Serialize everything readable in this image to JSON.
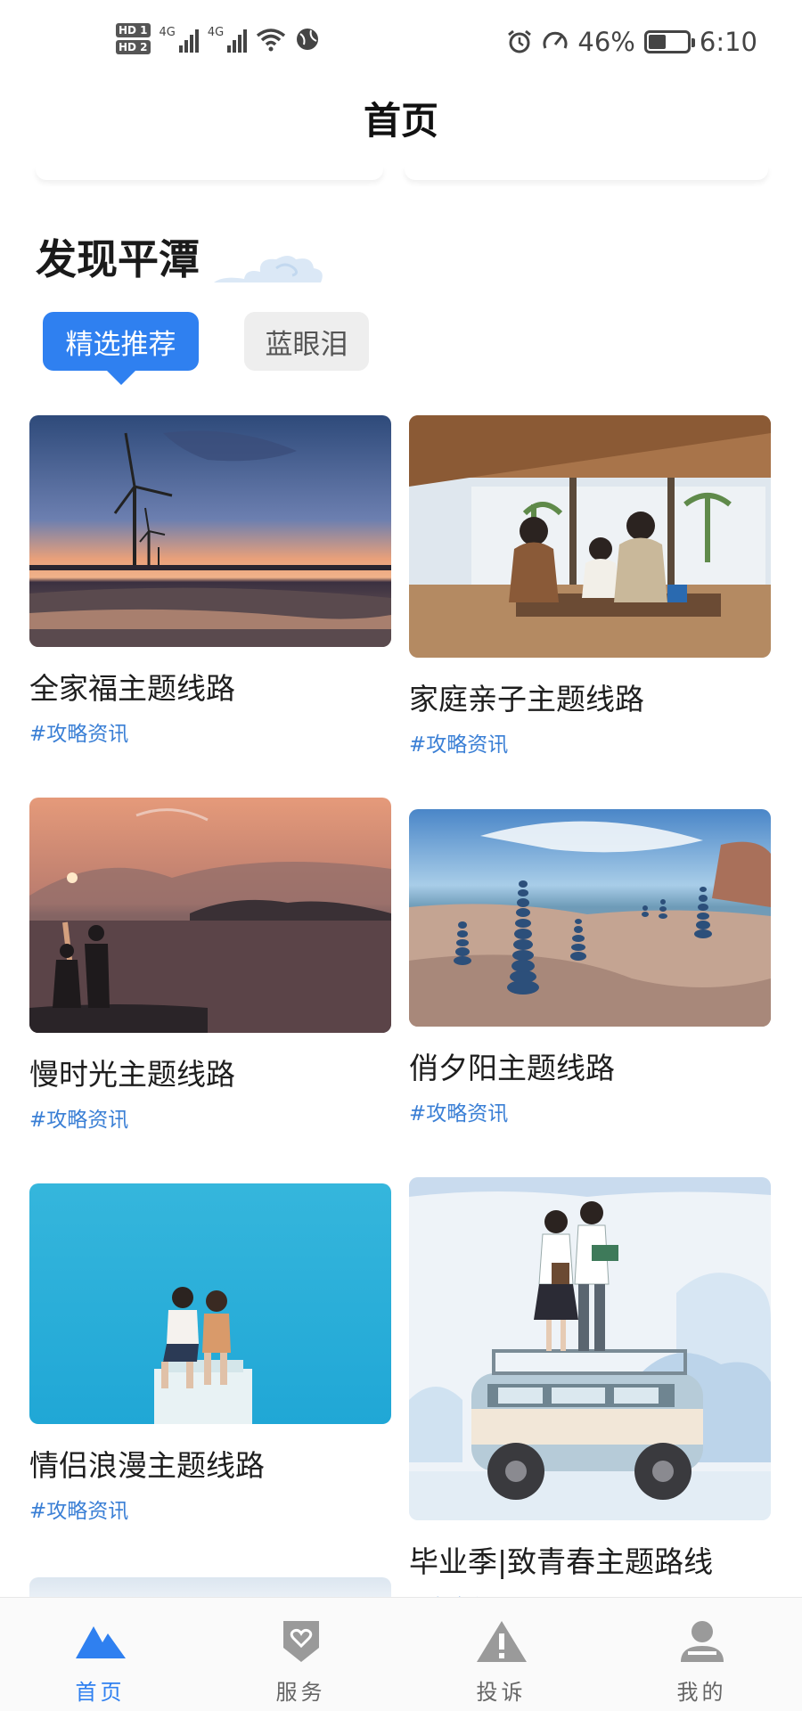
{
  "status_bar": {
    "hd1": "HD 1",
    "hd2": "HD 2",
    "net1": "4G",
    "net2": "4G",
    "battery_percent": "46%",
    "battery_level": 0.46,
    "time": "6:10",
    "icons": [
      "signal-icon",
      "wifi-icon",
      "alarm-icon",
      "speed-icon",
      "battery-icon"
    ]
  },
  "header": {
    "title": "首页"
  },
  "section": {
    "title": "发现平潭",
    "tabs": [
      {
        "label": "精选推荐",
        "active": true
      },
      {
        "label": "蓝眼泪",
        "active": false
      }
    ]
  },
  "routes": [
    {
      "name": "全家福主题线路",
      "tag": "#攻略资讯",
      "scene": "wind-turbine-sunset"
    },
    {
      "name": "家庭亲子主题线路",
      "tag": "#攻略资讯",
      "scene": "family-cafe-terrace"
    },
    {
      "name": "慢时光主题线路",
      "tag": "#攻略资讯",
      "scene": "silhouettes-sunset-sea"
    },
    {
      "name": "俏夕阳主题线路",
      "tag": "#攻略资讯",
      "scene": "stone-cairns-shore"
    },
    {
      "name": "情侣浪漫主题线路",
      "tag": "#攻略资讯",
      "scene": "couple-blue-wall"
    },
    {
      "name": "毕业季|致青春主题路线",
      "tag": "#攻略资讯",
      "scene": "graduates-on-van-illustration"
    }
  ],
  "bottom_nav": [
    {
      "label": "首页",
      "icon": "home-mountain-icon",
      "active": true
    },
    {
      "label": "服务",
      "icon": "service-heart-shield-icon",
      "active": false
    },
    {
      "label": "投诉",
      "icon": "complaint-warning-icon",
      "active": false
    },
    {
      "label": "我的",
      "icon": "profile-person-icon",
      "active": false
    }
  ],
  "colors": {
    "accent": "#2f80f0",
    "tag": "#3a7fd5"
  }
}
